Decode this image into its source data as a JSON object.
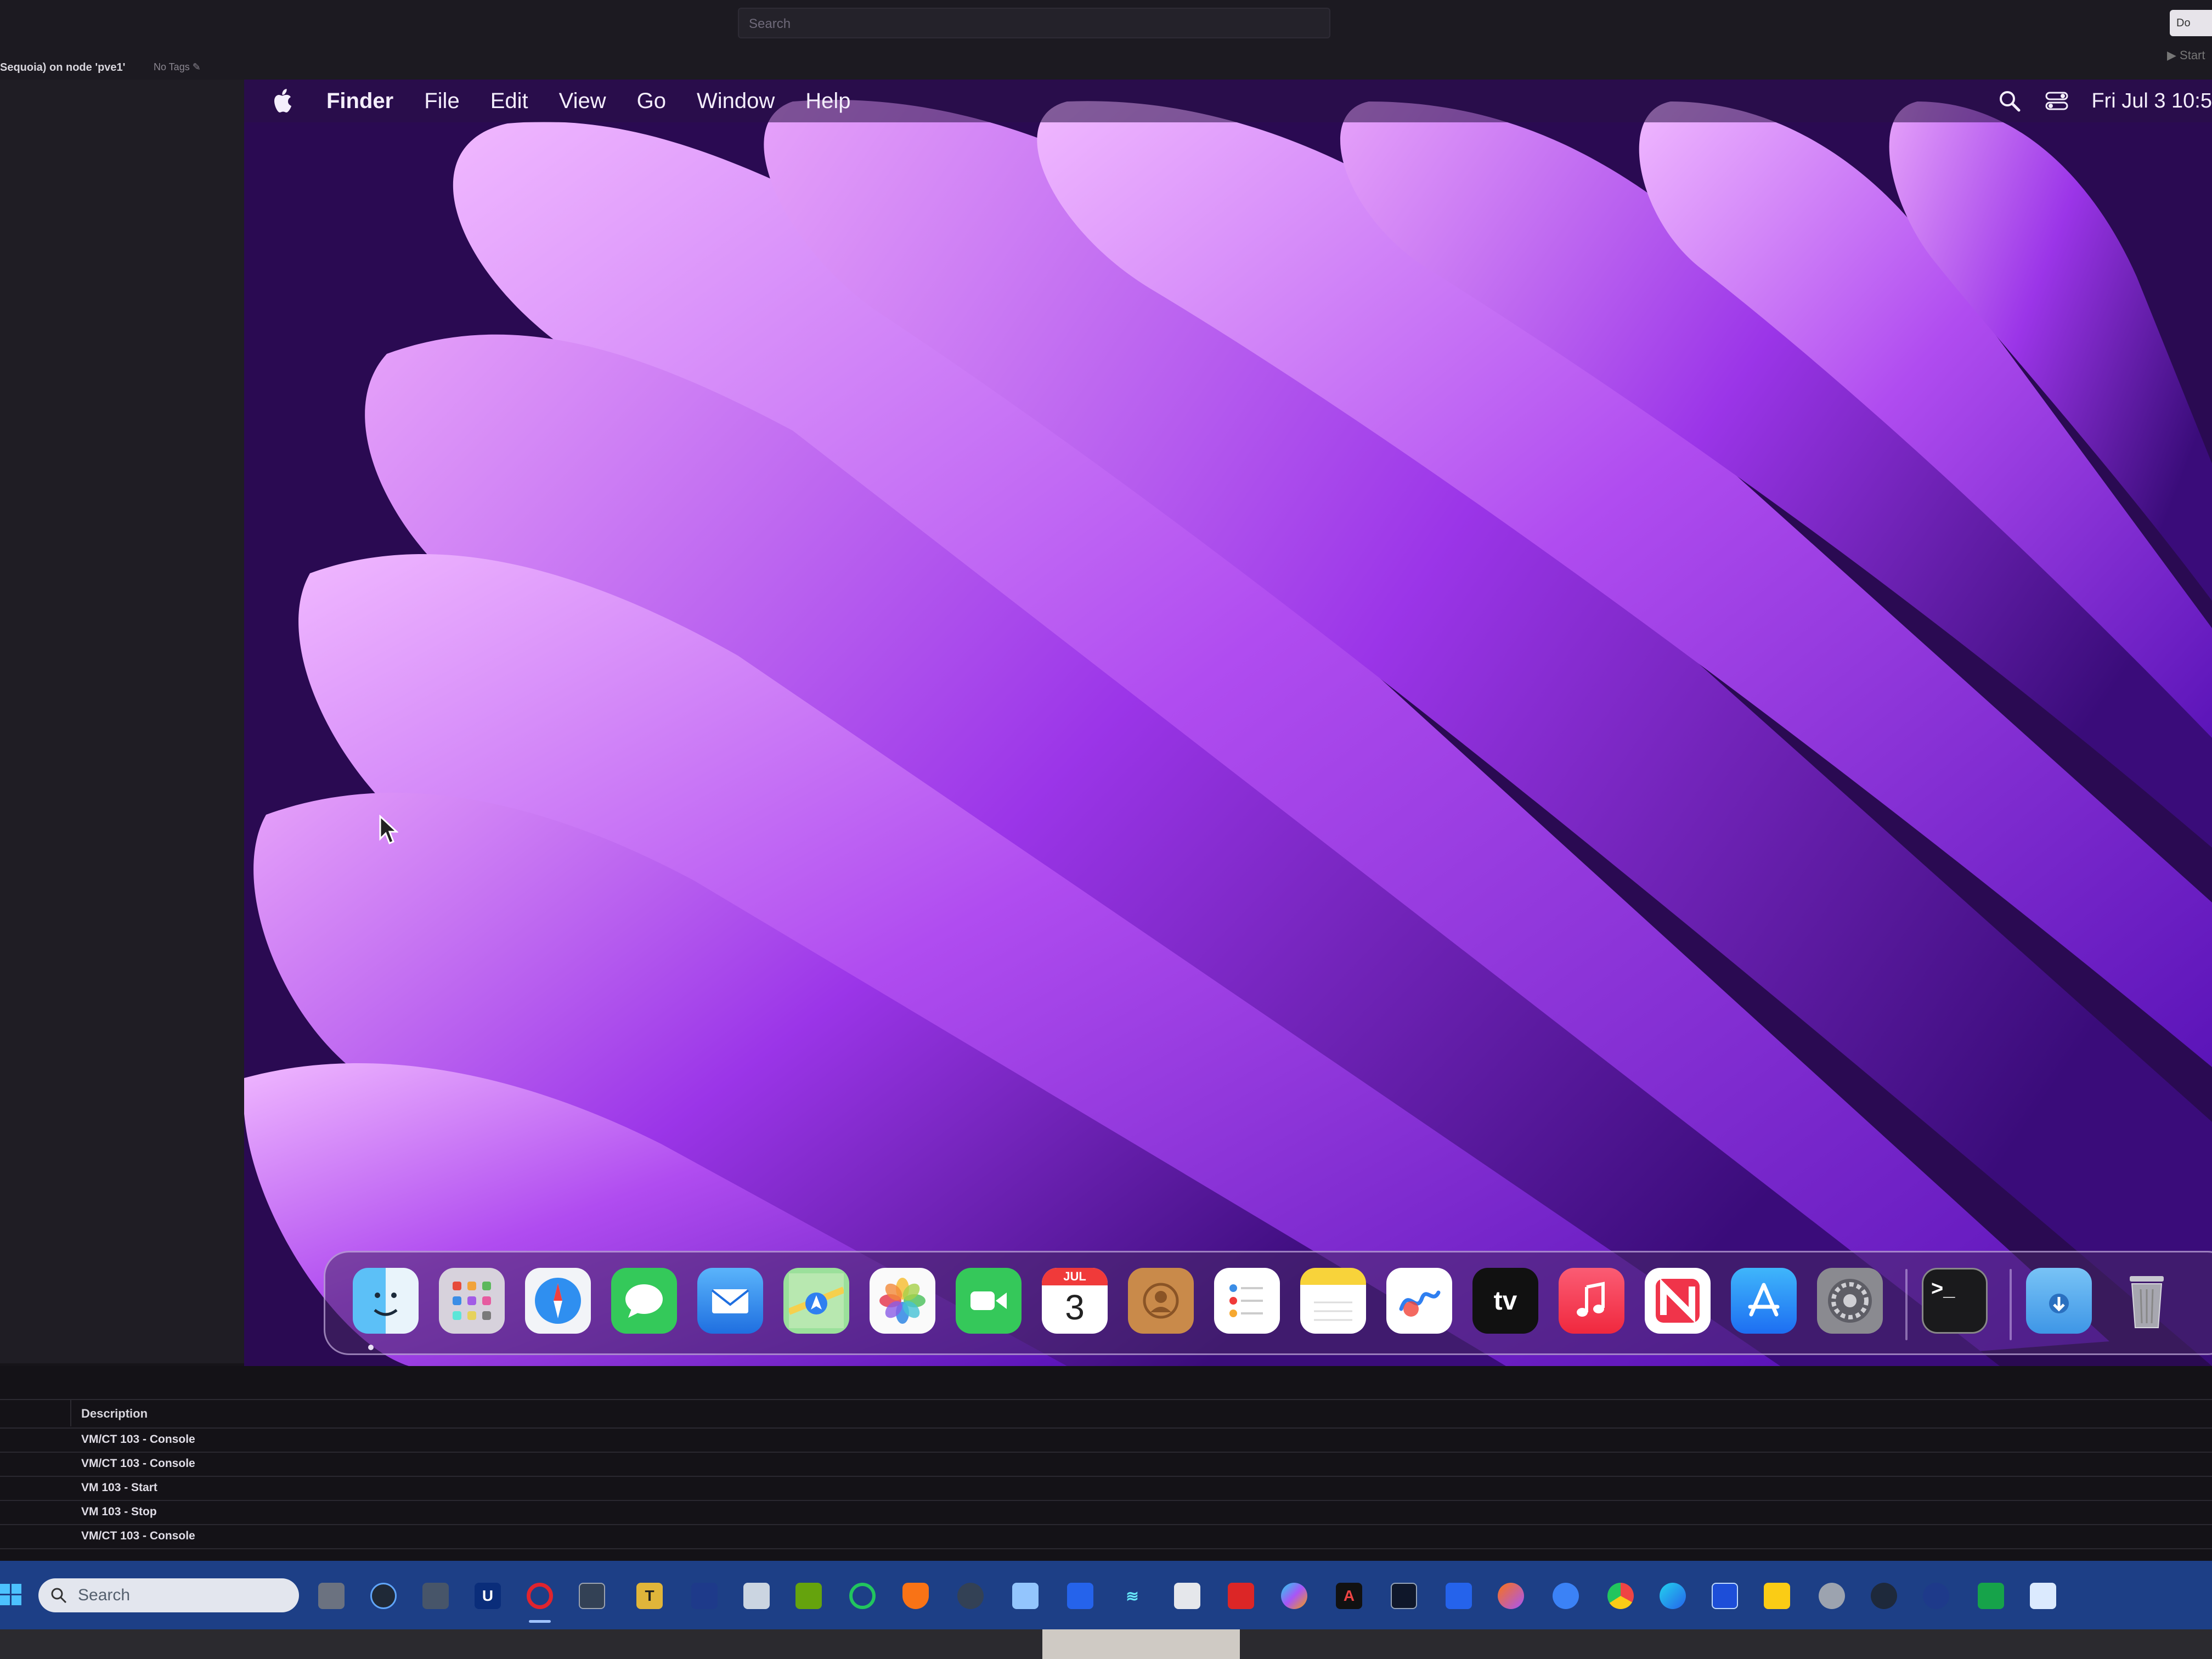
{
  "proxmox": {
    "search_placeholder": "Search",
    "right_button_label": "Do",
    "start_label": "▶ Start",
    "node_title": "Sequoia) on node 'pve1'",
    "tags_label": "No Tags"
  },
  "mac": {
    "menubar": {
      "app_name": "Finder",
      "items": [
        "File",
        "Edit",
        "View",
        "Go",
        "Window",
        "Help"
      ],
      "clock": "Fri Jul 3  10:5"
    },
    "dock": {
      "apps": [
        "Finder",
        "Launchpad",
        "Safari",
        "Messages",
        "Mail",
        "Maps",
        "Photos",
        "FaceTime",
        "Calendar",
        "Contacts",
        "Reminders",
        "Notes",
        "Freeform",
        "TV",
        "Music",
        "News",
        "App Store",
        "System Settings",
        "Terminal",
        "Downloads",
        "Trash"
      ],
      "calendar_month": "JUL",
      "calendar_day": "3",
      "tv_label": "tv",
      "terminal_prompt": ">_"
    }
  },
  "tasks": {
    "header": "Description",
    "rows": [
      "VM/CT 103 - Console",
      "VM/CT 103 - Console",
      "VM 103 - Start",
      "VM 103 - Stop",
      "VM/CT 103 - Console"
    ]
  },
  "taskbar": {
    "search_placeholder": "Search",
    "u_label": "U",
    "t_label": "T"
  }
}
